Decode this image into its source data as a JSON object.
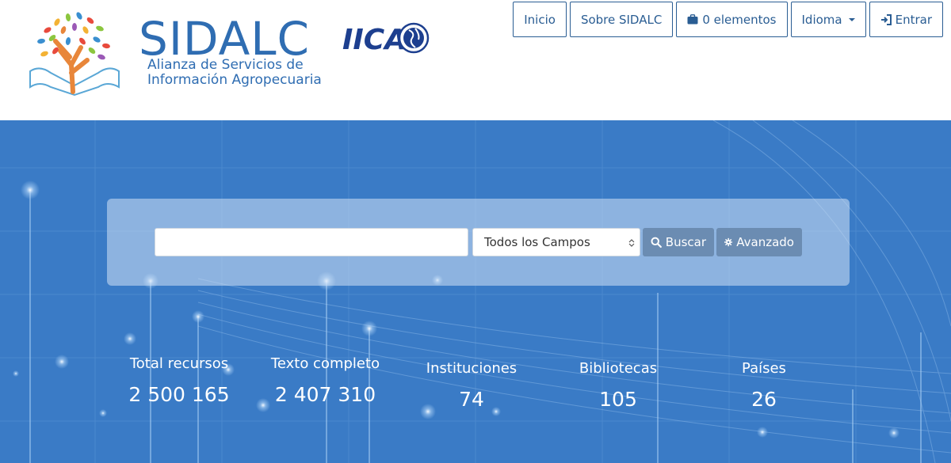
{
  "brand": {
    "name": "SIDALC",
    "subtitle_line1": "Alianza de Servicios de",
    "subtitle_line2": "Información Agropecuaria",
    "partner_logo_text": "IICA"
  },
  "nav": {
    "inicio": "Inicio",
    "sobre": "Sobre SIDALC",
    "cart": "0 elementos",
    "idioma": "Idioma",
    "entrar": "Entrar"
  },
  "search": {
    "query_value": "",
    "field_selected": "Todos los Campos",
    "search_label": "Buscar",
    "advanced_label": "Avanzado"
  },
  "stats": [
    {
      "label": "Total recursos",
      "value": "2 500 165"
    },
    {
      "label": "Texto completo",
      "value": "2 407 310"
    },
    {
      "label": "Instituciones",
      "value": "74"
    },
    {
      "label": "Bibliotecas",
      "value": "105"
    },
    {
      "label": "Países",
      "value": "26"
    }
  ],
  "colors": {
    "brand_blue": "#2f6db2",
    "hero_bg": "#3a7bc6",
    "nav_border": "#2a5d93",
    "button_bg": "#6b8cb2"
  },
  "icons": {
    "cart": "briefcase-icon",
    "search": "magnifier-icon",
    "advanced": "gear-icon",
    "login": "sign-in-icon"
  }
}
